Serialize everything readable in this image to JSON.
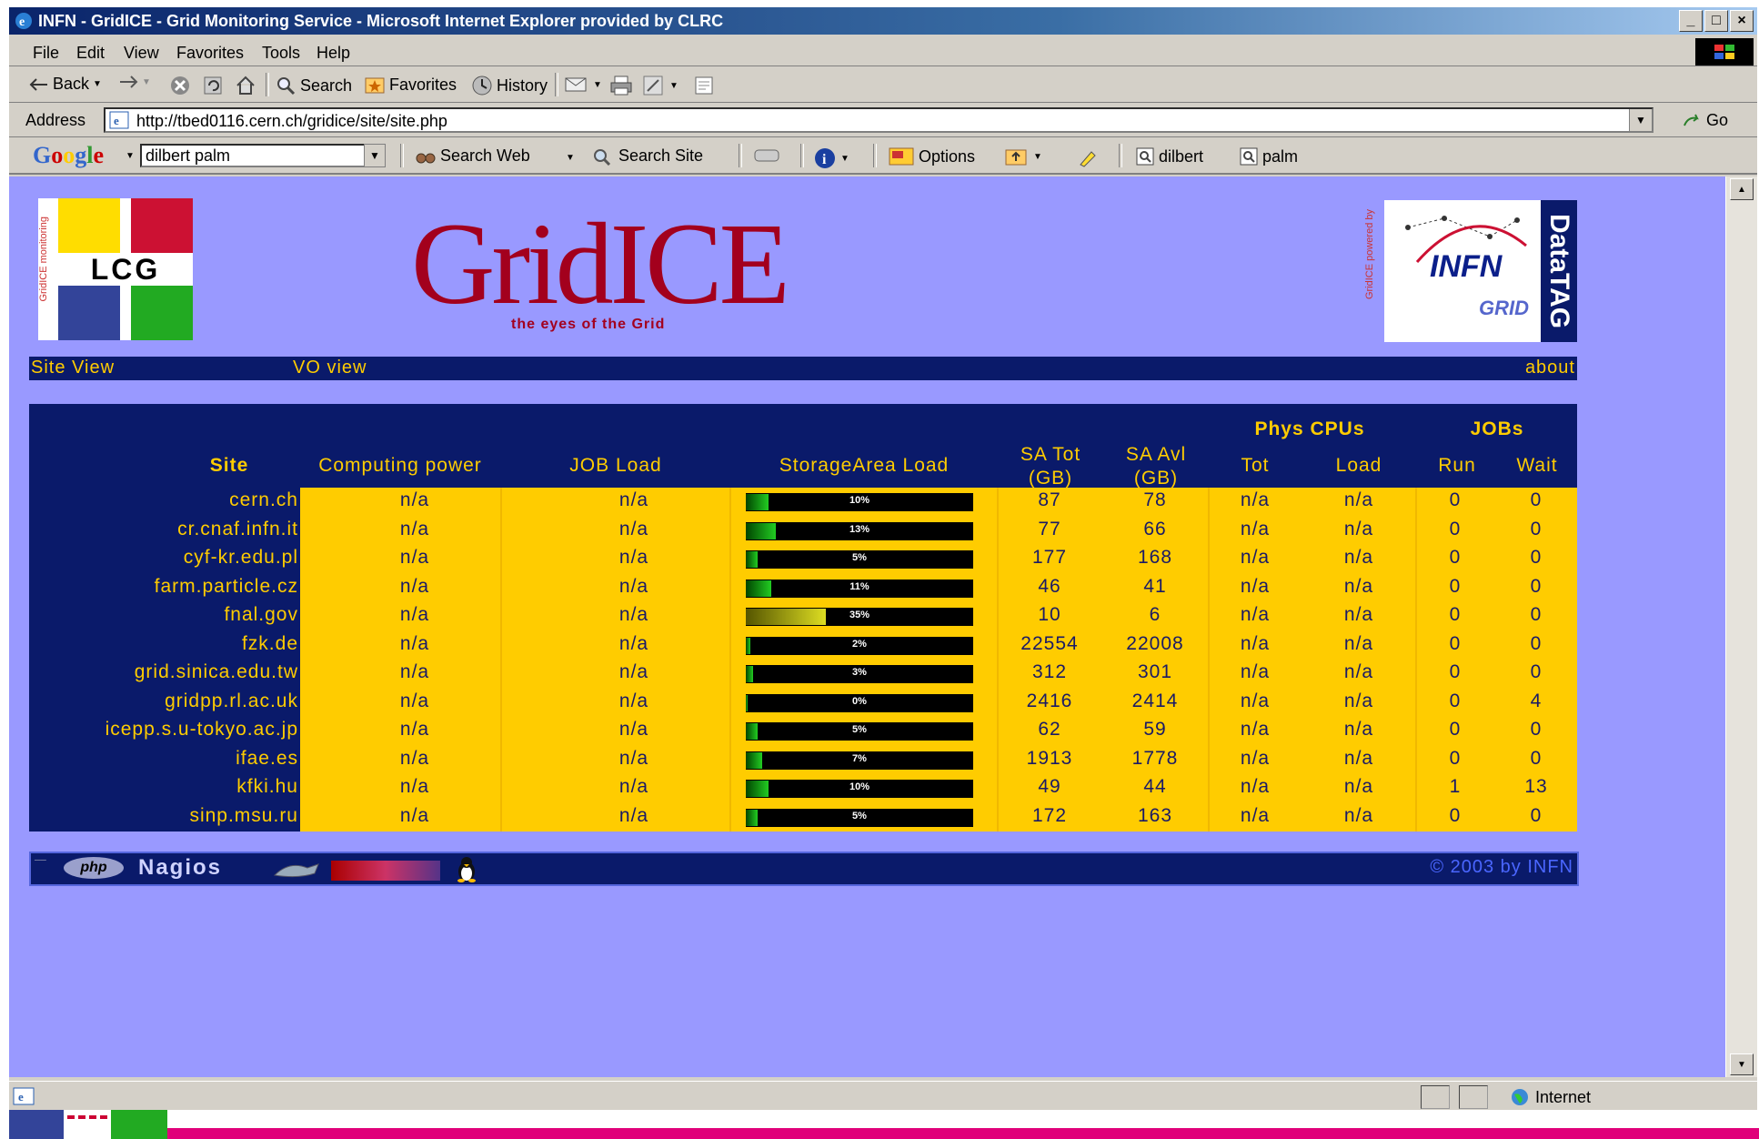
{
  "window": {
    "title": "INFN - GridICE - Grid Monitoring Service - Microsoft Internet Explorer provided by CLRC",
    "controls": [
      "_",
      "□",
      "×"
    ]
  },
  "menu": [
    "File",
    "Edit",
    "View",
    "Favorites",
    "Tools",
    "Help"
  ],
  "toolbar": {
    "back": "Back",
    "search": "Search",
    "favorites": "Favorites",
    "history": "History"
  },
  "address": {
    "label": "Address",
    "url": "http://tbed0116.cern.ch/gridice/site/site.php",
    "go": "Go"
  },
  "google_bar": {
    "logo": "Google",
    "query": "dilbert palm",
    "search_web": "Search Web",
    "search_site": "Search Site",
    "options": "Options",
    "highlight1": "dilbert",
    "highlight2": "palm"
  },
  "page": {
    "lcg_text": "LCG",
    "lcg_side": "GridICE monitoring",
    "gridice_title": "GridICE",
    "gridice_subtitle": "the eyes of the Grid",
    "infn_side": "GridICE powered by",
    "infn_brand": "INFN",
    "infn_grid": "GRID",
    "datatag": "DataTAG",
    "nav": {
      "site_view": "Site View",
      "vo_view": "VO view",
      "about": "about"
    },
    "table": {
      "headers": {
        "site": "Site",
        "computing_power": "Computing power",
        "job_load": "JOB Load",
        "storage_load": "StorageArea Load",
        "sa_tot": "SA Tot",
        "sa_tot_unit": "(GB)",
        "sa_avl": "SA Avl",
        "sa_avl_unit": "(GB)",
        "phys_cpus": "Phys CPUs",
        "cpu_tot": "Tot",
        "cpu_load": "Load",
        "jobs": "JOBs",
        "run": "Run",
        "wait": "Wait"
      },
      "rows": [
        {
          "site": "cern.ch",
          "power": "n/a",
          "job_load": "n/a",
          "storage_pct": 10,
          "storage_label": "10%",
          "sa_tot": "87",
          "sa_avl": "78",
          "cpu_tot": "n/a",
          "cpu_load": "n/a",
          "run": "0",
          "wait": "0"
        },
        {
          "site": "cr.cnaf.infn.it",
          "power": "n/a",
          "job_load": "n/a",
          "storage_pct": 13,
          "storage_label": "13%",
          "sa_tot": "77",
          "sa_avl": "66",
          "cpu_tot": "n/a",
          "cpu_load": "n/a",
          "run": "0",
          "wait": "0"
        },
        {
          "site": "cyf-kr.edu.pl",
          "power": "n/a",
          "job_load": "n/a",
          "storage_pct": 5,
          "storage_label": "5%",
          "sa_tot": "177",
          "sa_avl": "168",
          "cpu_tot": "n/a",
          "cpu_load": "n/a",
          "run": "0",
          "wait": "0"
        },
        {
          "site": "farm.particle.cz",
          "power": "n/a",
          "job_load": "n/a",
          "storage_pct": 11,
          "storage_label": "11%",
          "sa_tot": "46",
          "sa_avl": "41",
          "cpu_tot": "n/a",
          "cpu_load": "n/a",
          "run": "0",
          "wait": "0"
        },
        {
          "site": "fnal.gov",
          "power": "n/a",
          "job_load": "n/a",
          "storage_pct": 35,
          "storage_label": "35%",
          "sa_tot": "10",
          "sa_avl": "6",
          "cpu_tot": "n/a",
          "cpu_load": "n/a",
          "run": "0",
          "wait": "0"
        },
        {
          "site": "fzk.de",
          "power": "n/a",
          "job_load": "n/a",
          "storage_pct": 2,
          "storage_label": "2%",
          "sa_tot": "22554",
          "sa_avl": "22008",
          "cpu_tot": "n/a",
          "cpu_load": "n/a",
          "run": "0",
          "wait": "0"
        },
        {
          "site": "grid.sinica.edu.tw",
          "power": "n/a",
          "job_load": "n/a",
          "storage_pct": 3,
          "storage_label": "3%",
          "sa_tot": "312",
          "sa_avl": "301",
          "cpu_tot": "n/a",
          "cpu_load": "n/a",
          "run": "0",
          "wait": "0"
        },
        {
          "site": "gridpp.rl.ac.uk",
          "power": "n/a",
          "job_load": "n/a",
          "storage_pct": 0,
          "storage_label": "0%",
          "sa_tot": "2416",
          "sa_avl": "2414",
          "cpu_tot": "n/a",
          "cpu_load": "n/a",
          "run": "0",
          "wait": "4"
        },
        {
          "site": "icepp.s.u-tokyo.ac.jp",
          "power": "n/a",
          "job_load": "n/a",
          "storage_pct": 5,
          "storage_label": "5%",
          "sa_tot": "62",
          "sa_avl": "59",
          "cpu_tot": "n/a",
          "cpu_load": "n/a",
          "run": "0",
          "wait": "0"
        },
        {
          "site": "ifae.es",
          "power": "n/a",
          "job_load": "n/a",
          "storage_pct": 7,
          "storage_label": "7%",
          "sa_tot": "1913",
          "sa_avl": "1778",
          "cpu_tot": "n/a",
          "cpu_load": "n/a",
          "run": "0",
          "wait": "0"
        },
        {
          "site": "kfki.hu",
          "power": "n/a",
          "job_load": "n/a",
          "storage_pct": 10,
          "storage_label": "10%",
          "sa_tot": "49",
          "sa_avl": "44",
          "cpu_tot": "n/a",
          "cpu_load": "n/a",
          "run": "1",
          "wait": "13"
        },
        {
          "site": "sinp.msu.ru",
          "power": "n/a",
          "job_load": "n/a",
          "storage_pct": 5,
          "storage_label": "5%",
          "sa_tot": "172",
          "sa_avl": "163",
          "cpu_tot": "n/a",
          "cpu_load": "n/a",
          "run": "0",
          "wait": "0"
        }
      ]
    },
    "footer": {
      "php": "php",
      "nagios": "Nagios",
      "copyright": "© 2003 by INFN"
    }
  },
  "status": {
    "zone": "Internet"
  },
  "colors": {
    "page_bg": "#9999ff",
    "table_bg": "#0a1a6a",
    "cell_bg": "#ffcc00",
    "logo_red": "#a3001d"
  },
  "icons": [
    "ie-icon",
    "back-arrow-icon",
    "forward-arrow-icon",
    "stop-icon",
    "refresh-icon",
    "home-icon",
    "search-icon",
    "favorites-icon",
    "history-icon",
    "mail-icon",
    "print-icon",
    "edit-icon",
    "discuss-icon",
    "page-icon",
    "go-icon",
    "info-icon",
    "internet-globe-icon",
    "linux-tux-icon"
  ]
}
